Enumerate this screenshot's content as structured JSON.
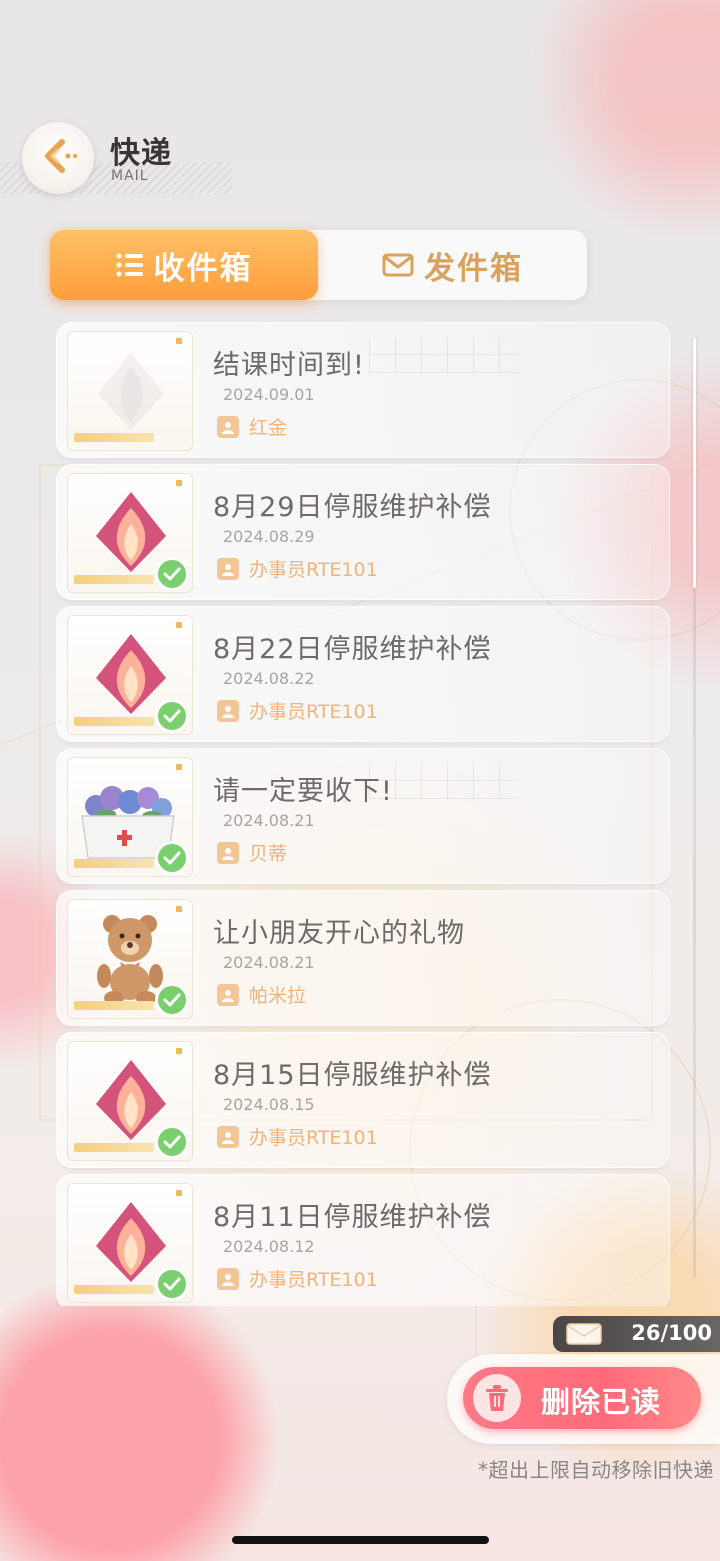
{
  "header": {
    "title": "快递",
    "subtitle": "MAIL",
    "back_icon": "chevron-left-icon"
  },
  "tabs": [
    {
      "label": "收件箱",
      "icon": "list-icon",
      "active": true
    },
    {
      "label": "发件箱",
      "icon": "envelope-icon",
      "active": false
    }
  ],
  "mails": [
    {
      "title": "结课时间到!",
      "date": "2024.09.01",
      "sender": "红金",
      "thumb": "faded-flame",
      "claimed": false
    },
    {
      "title": "8月29日停服维护补偿",
      "date": "2024.08.29",
      "sender": "办事员RTE101",
      "thumb": "flame-crystal",
      "claimed": true
    },
    {
      "title": "8月22日停服维护补偿",
      "date": "2024.08.22",
      "sender": "办事员RTE101",
      "thumb": "flame-crystal",
      "claimed": true
    },
    {
      "title": "请一定要收下!",
      "date": "2024.08.21",
      "sender": "贝蒂",
      "thumb": "flower-box",
      "claimed": true
    },
    {
      "title": "让小朋友开心的礼物",
      "date": "2024.08.21",
      "sender": "帕米拉",
      "thumb": "teddy-bear",
      "claimed": true
    },
    {
      "title": "8月15日停服维护补偿",
      "date": "2024.08.15",
      "sender": "办事员RTE101",
      "thumb": "flame-crystal",
      "claimed": true
    },
    {
      "title": "8月11日停服维护补偿",
      "date": "2024.08.12",
      "sender": "办事员RTE101",
      "thumb": "flame-crystal",
      "claimed": true
    }
  ],
  "capacity": {
    "count": "26/100",
    "icon": "mail-stack-icon"
  },
  "delete_button": {
    "label": "删除已读",
    "icon": "trash-icon"
  },
  "note": "*超出上限自动移除旧快递",
  "colors": {
    "accent_orange": "#ff9d3c",
    "delete_red": "#ff6a7a",
    "claimed_green": "#7ccf6f"
  }
}
